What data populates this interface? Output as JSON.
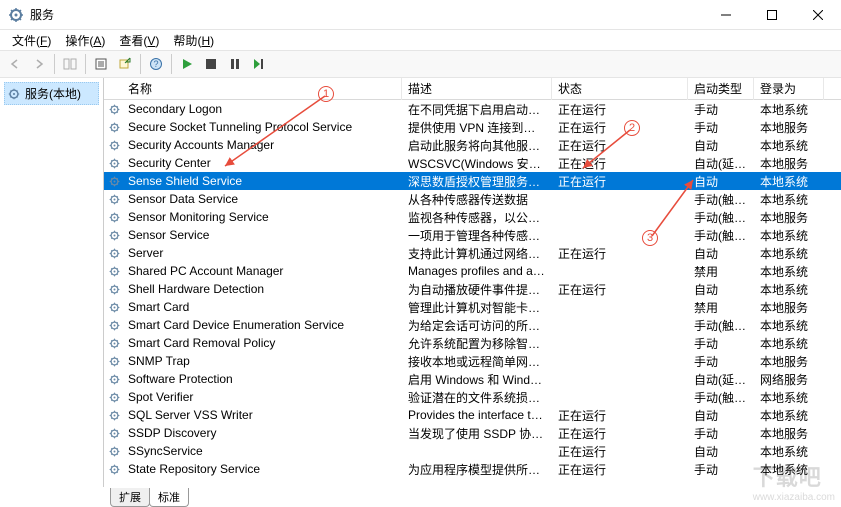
{
  "window": {
    "title": "服务"
  },
  "menu": {
    "file": {
      "label": "文件",
      "hotkey": "F"
    },
    "action": {
      "label": "操作",
      "hotkey": "A"
    },
    "view": {
      "label": "查看",
      "hotkey": "V"
    },
    "help": {
      "label": "帮助",
      "hotkey": "H"
    }
  },
  "sidebar": {
    "root": "服务(本地)"
  },
  "columns": {
    "name": "名称",
    "desc": "描述",
    "status": "状态",
    "startup": "启动类型",
    "logon": "登录为"
  },
  "statuses": {
    "running": "正在运行"
  },
  "tabs": {
    "extended": "扩展",
    "standard": "标准"
  },
  "annotations": {
    "n1": "1",
    "n2": "2",
    "n3": "3"
  },
  "watermark": {
    "big": "下载吧",
    "url": "www.xiazaiba.com"
  },
  "services": [
    {
      "name": "Secondary Logon",
      "desc": "在不同凭据下启用启动过程...",
      "status": "正在运行",
      "startup": "手动",
      "logon": "本地系统"
    },
    {
      "name": "Secure Socket Tunneling Protocol Service",
      "desc": "提供使用 VPN 连接到远程...",
      "status": "正在运行",
      "startup": "手动",
      "logon": "本地服务"
    },
    {
      "name": "Security Accounts Manager",
      "desc": "启动此服务将向其他服务发...",
      "status": "正在运行",
      "startup": "自动",
      "logon": "本地系统"
    },
    {
      "name": "Security Center",
      "desc": "WSCSVC(Windows 安全中...",
      "status": "正在运行",
      "startup": "自动(延迟...",
      "logon": "本地服务"
    },
    {
      "name": "Sense Shield Service",
      "desc": "深思数盾授权管理服务。禁...",
      "status": "正在运行",
      "startup": "自动",
      "logon": "本地系统",
      "selected": true
    },
    {
      "name": "Sensor Data Service",
      "desc": "从各种传感器传送数据",
      "status": "",
      "startup": "手动(触发...",
      "logon": "本地系统"
    },
    {
      "name": "Sensor Monitoring Service",
      "desc": "监视各种传感器，以公开数...",
      "status": "",
      "startup": "手动(触发...",
      "logon": "本地服务"
    },
    {
      "name": "Sensor Service",
      "desc": "一项用于管理各种传感器的...",
      "status": "",
      "startup": "手动(触发...",
      "logon": "本地系统"
    },
    {
      "name": "Server",
      "desc": "支持此计算机通过网络的文...",
      "status": "正在运行",
      "startup": "自动",
      "logon": "本地系统"
    },
    {
      "name": "Shared PC Account Manager",
      "desc": "Manages profiles and ac...",
      "status": "",
      "startup": "禁用",
      "logon": "本地系统"
    },
    {
      "name": "Shell Hardware Detection",
      "desc": "为自动播放硬件事件提供通...",
      "status": "正在运行",
      "startup": "自动",
      "logon": "本地系统"
    },
    {
      "name": "Smart Card",
      "desc": "管理此计算机对智能卡的取...",
      "status": "",
      "startup": "禁用",
      "logon": "本地服务"
    },
    {
      "name": "Smart Card Device Enumeration Service",
      "desc": "为给定会话可访问的所有智...",
      "status": "",
      "startup": "手动(触发...",
      "logon": "本地系统"
    },
    {
      "name": "Smart Card Removal Policy",
      "desc": "允许系统配置为移除智能卡...",
      "status": "",
      "startup": "手动",
      "logon": "本地系统"
    },
    {
      "name": "SNMP Trap",
      "desc": "接收本地或远程简单网络管...",
      "status": "",
      "startup": "手动",
      "logon": "本地服务"
    },
    {
      "name": "Software Protection",
      "desc": "启用 Windows 和 Windo...",
      "status": "",
      "startup": "自动(延迟...",
      "logon": "网络服务"
    },
    {
      "name": "Spot Verifier",
      "desc": "验证潜在的文件系统损坏。",
      "status": "",
      "startup": "手动(触发...",
      "logon": "本地系统"
    },
    {
      "name": "SQL Server VSS Writer",
      "desc": "Provides the interface to ...",
      "status": "正在运行",
      "startup": "自动",
      "logon": "本地系统"
    },
    {
      "name": "SSDP Discovery",
      "desc": "当发现了使用 SSDP 协议的...",
      "status": "正在运行",
      "startup": "手动",
      "logon": "本地服务"
    },
    {
      "name": "SSyncService",
      "desc": "",
      "status": "正在运行",
      "startup": "自动",
      "logon": "本地系统"
    },
    {
      "name": "State Repository Service",
      "desc": "为应用程序模型提供所需的...",
      "status": "正在运行",
      "startup": "手动",
      "logon": "本地系统"
    }
  ]
}
